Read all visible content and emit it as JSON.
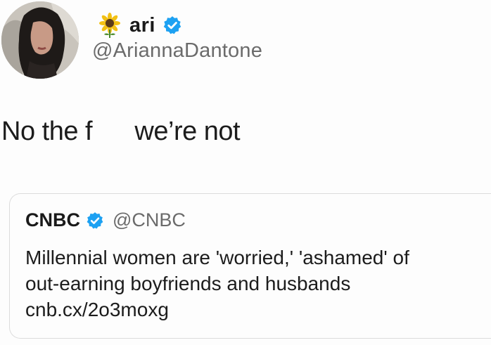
{
  "author": {
    "display_name": "ari",
    "handle": "@AriannaDantone",
    "name_emoji": "sunflower-icon",
    "verified": true
  },
  "tweet": {
    "text": "No the f      we’re not"
  },
  "quoted_tweet": {
    "display_name": "CNBC",
    "handle": "@CNBC",
    "verified": true,
    "text_lines": [
      "Millennial women are 'worried,' 'ashamed' of",
      "out-earning boyfriends and husbands",
      "cnb.cx/2o3moxg"
    ]
  },
  "colors": {
    "verified_badge": "#1da1f2",
    "handle_text": "#6b6b6b",
    "card_border": "#dcdcdc"
  }
}
